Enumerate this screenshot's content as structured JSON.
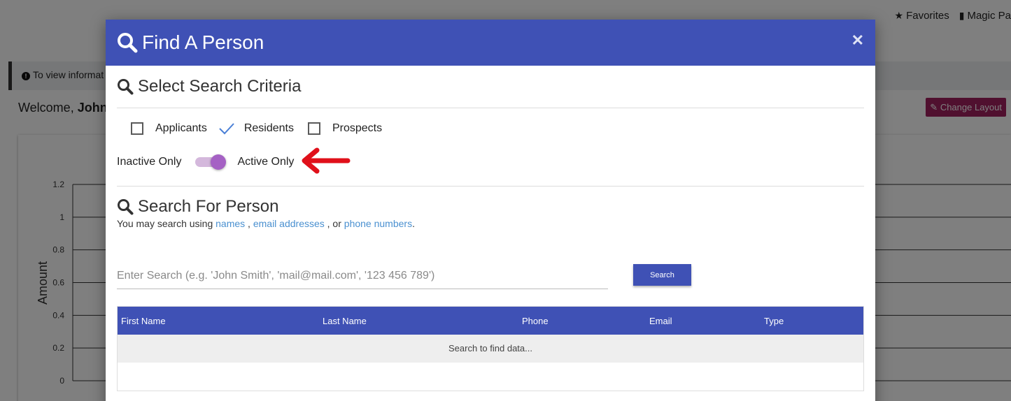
{
  "background": {
    "top_links": [
      {
        "icon": "star-icon",
        "label": "Favorites"
      },
      {
        "icon": "building-icon",
        "label": "Magic Pa"
      }
    ],
    "info_text": "To view informat",
    "welcome_prefix": "Welcome,",
    "welcome_name": "John",
    "change_layout_label": "Change Layout",
    "chart_data": {
      "type": "line",
      "ylabel": "Amount",
      "ylim": [
        0,
        1.2
      ],
      "yticks": [
        "1.2",
        "1",
        "0.8",
        "0.6",
        "0.4",
        "0.2",
        "0"
      ],
      "series": []
    }
  },
  "modal": {
    "title": "Find A Person",
    "criteria_title": "Select Search Criteria",
    "checkboxes": [
      {
        "label": "Applicants",
        "checked": false
      },
      {
        "label": "Residents",
        "checked": true
      },
      {
        "label": "Prospects",
        "checked": false
      }
    ],
    "toggle": {
      "left_label": "Inactive Only",
      "right_label": "Active Only",
      "state": "active"
    },
    "search_title": "Search For Person",
    "hint": {
      "prefix": "You may search using",
      "link1": "names",
      "sep1": ",",
      "link2": "email addresses",
      "sep2": ", or",
      "link3": "phone numbers",
      "suffix": "."
    },
    "search_placeholder": "Enter Search (e.g. 'John Smith', 'mail@mail.com', '123 456 789')",
    "search_button": "Search",
    "table": {
      "columns": [
        "First Name",
        "Last Name",
        "Phone",
        "Email",
        "Type"
      ],
      "empty_text": "Search to find data..."
    }
  },
  "colors": {
    "primary": "#3f51b5",
    "toggle_thumb": "#a561c4",
    "change_layout": "#a0205f",
    "link": "#4a90d0",
    "annotation_arrow": "#e0101a"
  }
}
